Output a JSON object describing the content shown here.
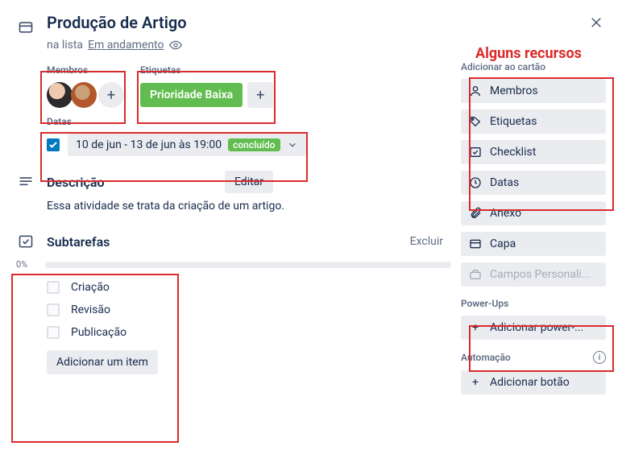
{
  "card": {
    "title": "Produção de Artigo",
    "subtitle_prefix": "na lista",
    "list_name": "Em andamento"
  },
  "members": {
    "heading": "Membros"
  },
  "labels": {
    "heading": "Etiquetas",
    "items": [
      "Prioridade Baixa"
    ]
  },
  "dates": {
    "heading": "Datas",
    "range": "10 de jun - 13 de jun às 19:00",
    "status": "concluído",
    "checked": true
  },
  "description": {
    "heading": "Descrição",
    "edit": "Editar",
    "text": "Essa atividade se trata da criação de um artigo."
  },
  "checklist": {
    "heading": "Subtarefas",
    "delete": "Excluir",
    "progress": "0%",
    "items": [
      {
        "label": "Criação",
        "checked": false
      },
      {
        "label": "Revisão",
        "checked": false
      },
      {
        "label": "Publicação",
        "checked": false
      }
    ],
    "add_item": "Adicionar um item"
  },
  "annotation": {
    "title": "Alguns recursos"
  },
  "sidebar": {
    "add_heading": "Adicionar ao cartão",
    "buttons": {
      "members": "Membros",
      "labels": "Etiquetas",
      "checklist": "Checklist",
      "dates": "Datas",
      "attachment": "Anexo",
      "cover": "Capa",
      "custom_fields": "Campos Personali..."
    },
    "powerups_heading": "Power-Ups",
    "powerups_add": "Adicionar power-...",
    "automation_heading": "Automação",
    "automation_add": "Adicionar botão"
  }
}
